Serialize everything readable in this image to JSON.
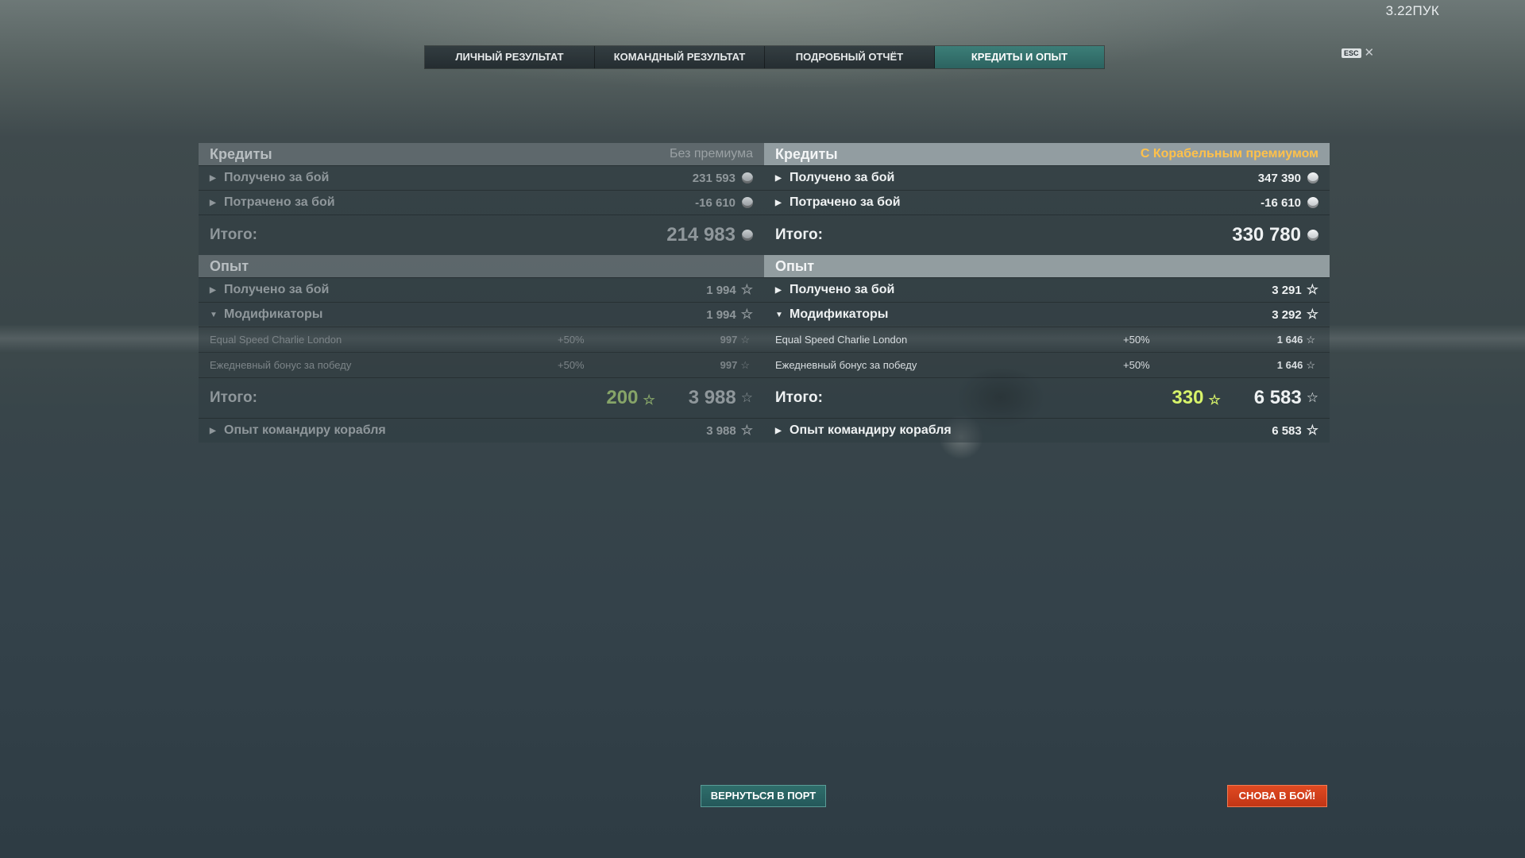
{
  "version": "3.22ПУК",
  "tabs": [
    "ЛИЧНЫЙ РЕЗУЛЬТАТ",
    "КОМАНДНЫЙ РЕЗУЛЬТАТ",
    "ПОДРОБНЫЙ ОТЧЁТ",
    "КРЕДИТЫ И ОПЫТ"
  ],
  "active_tab": "КРЕДИТЫ И ОПЫТ",
  "close": {
    "key": "ESC",
    "icon": "close-icon"
  },
  "left": {
    "credits_title": "Кредиты",
    "tag": "Без премиума",
    "earned_label": "Получено за бой",
    "earned": "231 593",
    "spent_label": "Потрачено за бой",
    "spent": "-16 610",
    "total_label": "Итого:",
    "credits_total": "214 983",
    "xp_title": "Опыт",
    "xp_earned_label": "Получено за бой",
    "xp_earned": "1 994",
    "mods_label": "Модификаторы",
    "mods": "1 994",
    "mod1": {
      "name": "Equal Speed Charlie London",
      "pct": "+50%",
      "val": "997"
    },
    "mod2": {
      "name": "Ежедневный бонус за победу",
      "pct": "+50%",
      "val": "997"
    },
    "xp_total_label": "Итого:",
    "xp_bonus": "200",
    "xp_total": "3 988",
    "captain_label": "Опыт командиру корабля",
    "captain": "3 988"
  },
  "right": {
    "credits_title": "Кредиты",
    "tag": "С Корабельным премиумом",
    "earned_label": "Получено за бой",
    "earned": "347 390",
    "spent_label": "Потрачено за бой",
    "spent": "-16 610",
    "total_label": "Итого:",
    "credits_total": "330 780",
    "xp_title": "Опыт",
    "xp_earned_label": "Получено за бой",
    "xp_earned": "3 291",
    "mods_label": "Модификаторы",
    "mods": "3 292",
    "mod1": {
      "name": "Equal Speed Charlie London",
      "pct": "+50%",
      "val": "1 646"
    },
    "mod2": {
      "name": "Ежедневный бонус за победу",
      "pct": "+50%",
      "val": "1 646"
    },
    "xp_total_label": "Итого:",
    "xp_bonus": "330",
    "xp_total": "6 583",
    "captain_label": "Опыт командиру корабля",
    "captain": "6 583"
  },
  "buttons": {
    "port": "ВЕРНУТЬСЯ В ПОРТ",
    "again": "СНОВА В БОЙ!"
  },
  "colors": {
    "premium_tag": "#ffc14a",
    "bonus_xp_right": "#d7f36a",
    "bonus_xp_left": "#86a468",
    "active_tab": "#2c6360",
    "battle_button": "#c23515"
  }
}
